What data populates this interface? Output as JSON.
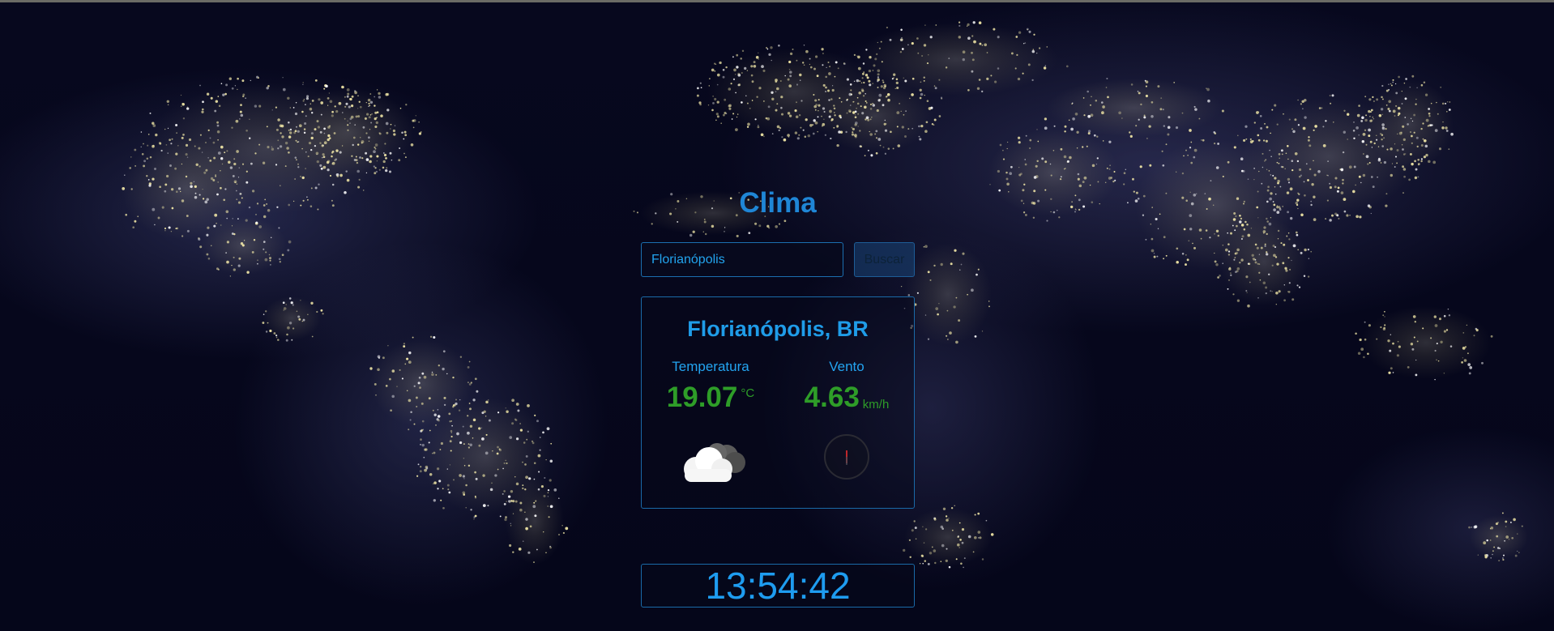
{
  "app": {
    "title": "Clima"
  },
  "search": {
    "value": "Florianópolis",
    "button_label": "Buscar"
  },
  "weather": {
    "location": "Florianópolis, BR",
    "temperature": {
      "label": "Temperatura",
      "value": "19.07",
      "unit": "°C",
      "condition_icon": "cloud-icon"
    },
    "wind": {
      "label": "Vento",
      "value": "4.63",
      "unit": "km/h",
      "direction_icon": "compass-icon"
    }
  },
  "clock": {
    "time": "13:54:42"
  },
  "colors": {
    "accent": "#1f86d6",
    "value": "#2e9d28",
    "background": "#05061a"
  }
}
